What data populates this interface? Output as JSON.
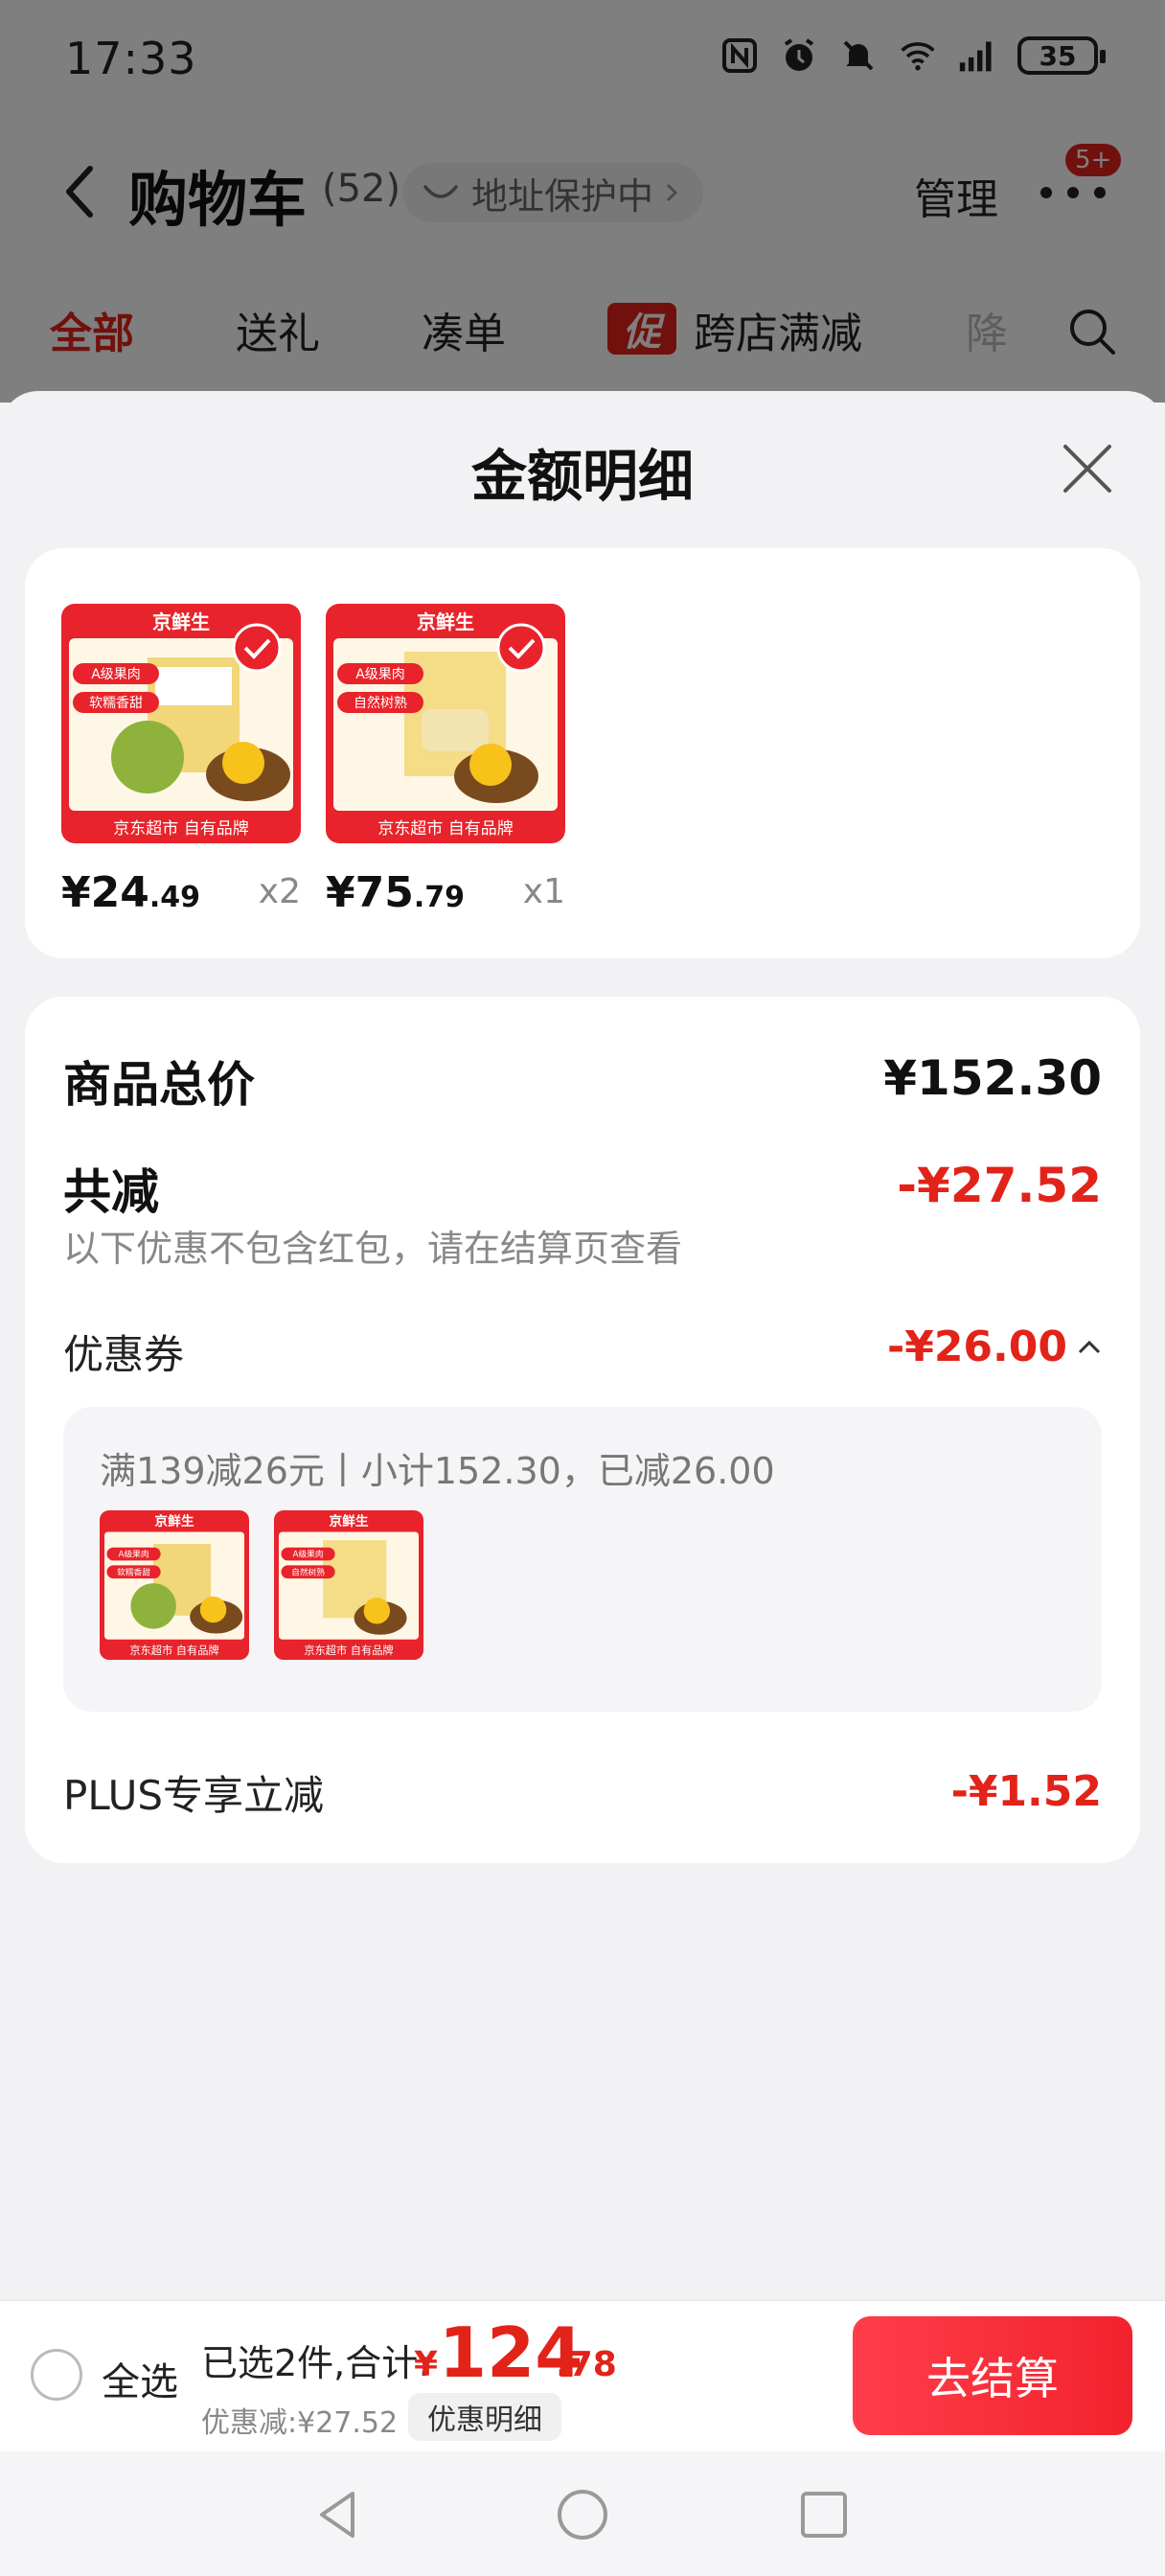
{
  "status": {
    "time": "17:33",
    "battery": "35"
  },
  "cart_header": {
    "title": "购物车",
    "count": "(52)",
    "address_chip": "地址保护中",
    "manage": "管理",
    "badge": "5+"
  },
  "tabs": [
    "全部",
    "送礼",
    "凑单",
    "跨店满减",
    "降"
  ],
  "tabs_promo_tag": "促",
  "sheet": {
    "title": "金额明细"
  },
  "products": [
    {
      "price_int": "¥24",
      "price_dec": ".49",
      "qty": "x2",
      "brand": "京鲜生",
      "tag1": "A级果肉",
      "tag2": "软糯香甜",
      "footer": "京东超市 自有品牌"
    },
    {
      "price_int": "¥75",
      "price_dec": ".79",
      "qty": "x1",
      "brand": "京鲜生",
      "tag1": "A级果肉",
      "tag2": "自然树熟",
      "footer": "京东超市 自有品牌"
    }
  ],
  "detail": {
    "total_label": "商品总价",
    "total_value": "¥152.30",
    "reduce_label": "共减",
    "reduce_value": "-¥27.52",
    "note": "以下优惠不包含红包，请在结算页查看",
    "coupon_label": "优惠券",
    "coupon_value": "-¥26.00",
    "coupon_desc": "满139减26元丨小计152.30，已减26.00",
    "plus_label": "PLUS专享立减",
    "plus_value": "-¥1.52"
  },
  "bottom": {
    "select_all": "全选",
    "summary_prefix": "已选2件,合计:",
    "yen": "¥",
    "total_int": "124",
    "total_dec": ".78",
    "discount": "优惠减:¥27.52",
    "detail_chip": "优惠明细",
    "checkout": "去结算"
  },
  "colors": {
    "accent": "#e2231a",
    "background": "#f2f2f4"
  }
}
